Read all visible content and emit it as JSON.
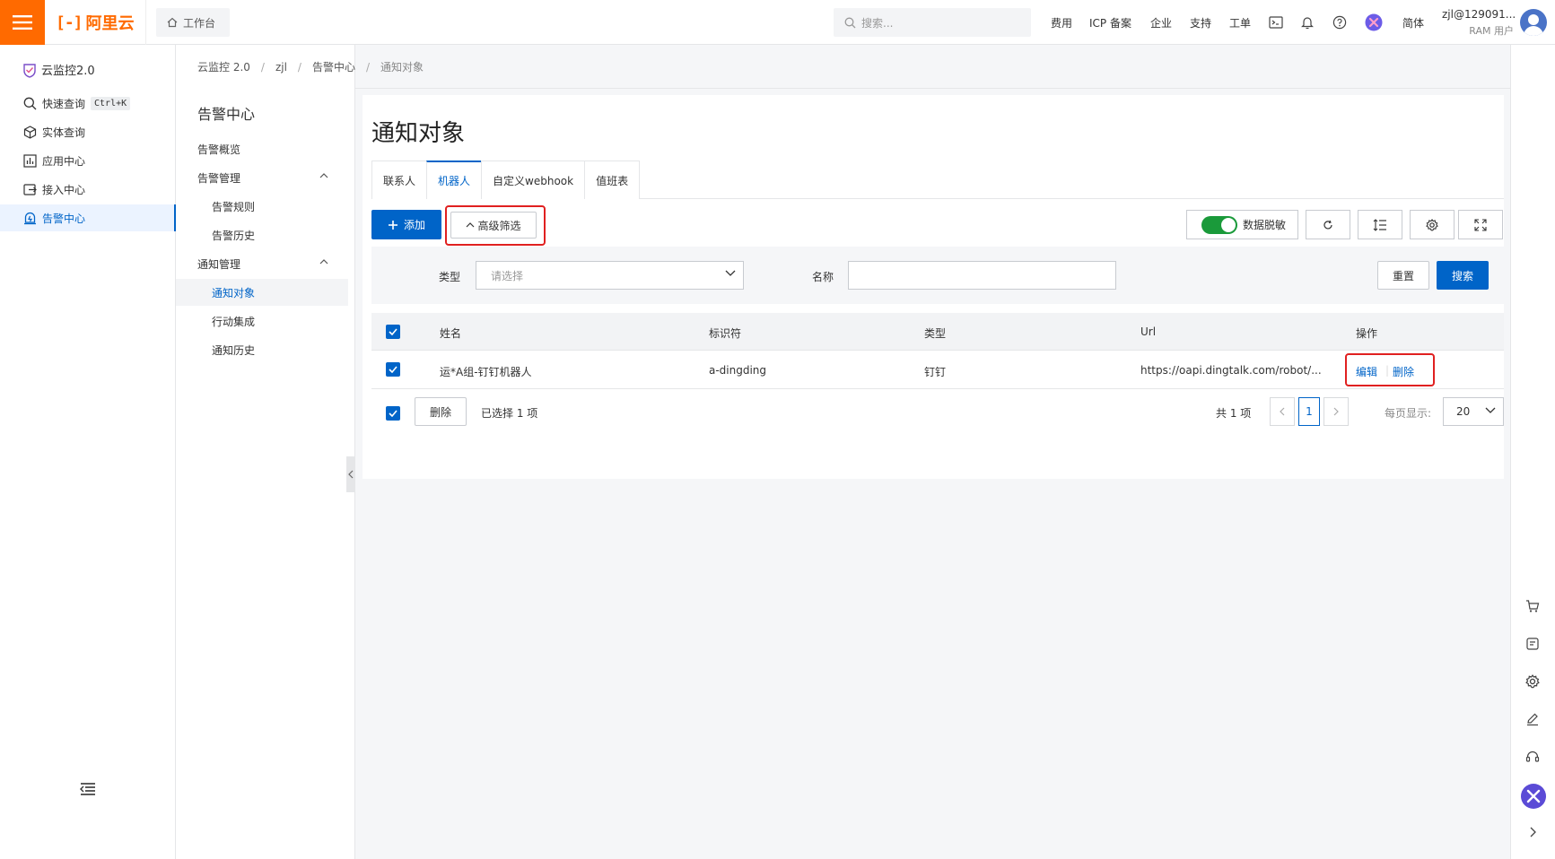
{
  "topbar": {
    "logo_text": "阿里云",
    "workbench": "工作台",
    "search_placeholder": "搜索...",
    "nav": [
      "费用",
      "ICP 备案",
      "企业",
      "支持",
      "工单"
    ],
    "lang": "简体",
    "user_name": "zjl@129091...",
    "user_type": "RAM 用户"
  },
  "sidebar": {
    "product": "云监控2.0",
    "items": [
      {
        "label": "快速查询",
        "shortcut": "Ctrl+K"
      },
      {
        "label": "实体查询"
      },
      {
        "label": "应用中心"
      },
      {
        "label": "接入中心"
      },
      {
        "label": "告警中心"
      }
    ]
  },
  "subnav": {
    "title": "告警中心",
    "items": [
      {
        "label": "告警概览"
      },
      {
        "label": "告警管理"
      },
      {
        "label": "告警规则"
      },
      {
        "label": "告警历史"
      },
      {
        "label": "通知管理"
      },
      {
        "label": "通知对象"
      },
      {
        "label": "行动集成"
      },
      {
        "label": "通知历史"
      }
    ]
  },
  "breadcrumb": [
    "云监控 2.0",
    "zjl",
    "告警中心",
    "通知对象"
  ],
  "page_title": "通知对象",
  "tabs": [
    "联系人",
    "机器人",
    "自定义webhook",
    "值班表"
  ],
  "toolbar": {
    "add": "添加",
    "advanced_filter": "高级筛选",
    "data_mask": "数据脱敏"
  },
  "filter": {
    "type_label": "类型",
    "type_placeholder": "请选择",
    "name_label": "名称",
    "reset": "重置",
    "search": "搜索"
  },
  "table": {
    "columns": [
      "姓名",
      "标识符",
      "类型",
      "Url",
      "操作"
    ],
    "rows": [
      {
        "name": "运*A组-钉钉机器人",
        "identifier": "a-dingding",
        "type": "钉钉",
        "url": "https://oapi.dingtalk.com/robot/...",
        "edit": "编辑",
        "delete": "删除"
      }
    ]
  },
  "footer": {
    "delete": "删除",
    "selected": "已选择 1 项",
    "total": "共 1 项",
    "current_page": "1",
    "page_size_label": "每页显示:",
    "page_size": "20"
  },
  "colors": {
    "accent": "#0064c8",
    "brand": "#ff6a00",
    "highlight_box": "#e02020",
    "toggle_on": "#1a9a3a"
  }
}
